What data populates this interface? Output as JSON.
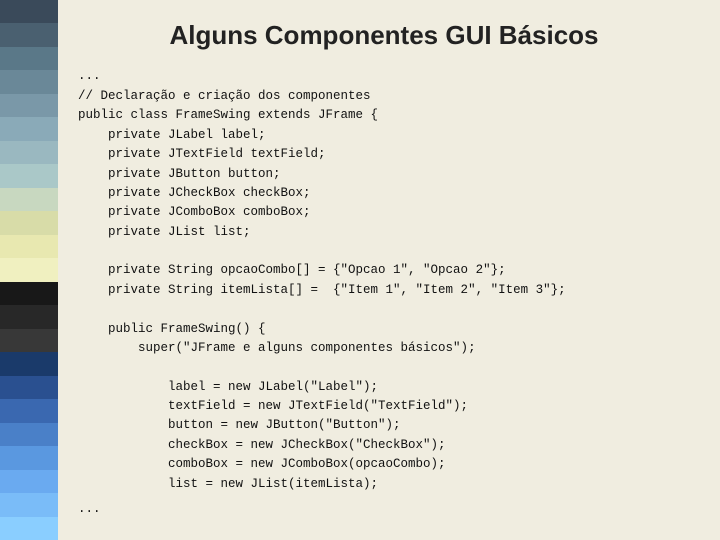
{
  "sidebar": {
    "colors": [
      "#3a4a5a",
      "#4a6070",
      "#5a7888",
      "#6a8898",
      "#7a98a8",
      "#8aaab8",
      "#9ab8c0",
      "#aac8c8",
      "#c8d8c0",
      "#d8dca8",
      "#e8e8b0",
      "#f0f0c0",
      "#181818",
      "#282828",
      "#383838",
      "#1a3a6a",
      "#2a5090",
      "#3a68b0",
      "#4a80c8",
      "#5a98e0",
      "#6aaaf0",
      "#7abcf8",
      "#8aceff"
    ]
  },
  "title": "Alguns Componentes GUI Básicos",
  "code": {
    "ellipsis_top": "...",
    "line1": "// Declaração e criação dos componentes",
    "line2": "public class FrameSwing extends JFrame {",
    "line3": "    private JLabel label;",
    "line4": "    private JTextField textField;",
    "line5": "    private JButton button;",
    "line6": "    private JCheckBox checkBox;",
    "line7": "    private JComboBox comboBox;",
    "line8": "    private JList list;",
    "line9": "",
    "line10": "    private String opcaoCombo[] = {\"Opcao 1\", \"Opcao 2\"};",
    "line11": "    private String itemLista[] =  {\"Item 1\", \"Item 2\", \"Item 3\"};",
    "line12": "",
    "line13": "    public FrameSwing() {",
    "line14": "        super(\"JFrame e alguns componentes básicos\");",
    "line15": "",
    "line16": "            label = new JLabel(\"Label\");",
    "line17": "            textField = new JTextField(\"TextField\");",
    "line18": "            button = new JButton(\"Button\");",
    "line19": "            checkBox = new JCheckBox(\"CheckBox\");",
    "line20": "            comboBox = new JComboBox(opcaoCombo);",
    "line21": "            list = new JList(itemLista);",
    "ellipsis_bottom": "..."
  }
}
